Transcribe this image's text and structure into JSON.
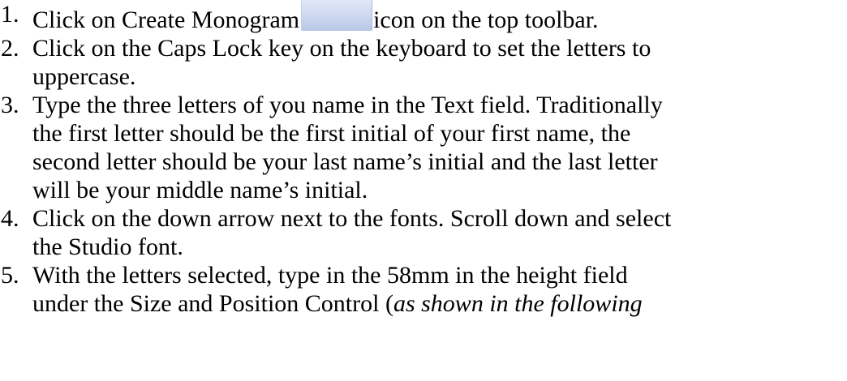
{
  "steps": [
    {
      "number": "1.",
      "lines": [
        "Click on Create Monogram",
        "icon on the top toolbar."
      ],
      "icon": "create-monogram-icon"
    },
    {
      "number": "2.",
      "lines": [
        "Click on the Caps Lock key on the keyboard to set the letters to",
        "uppercase."
      ]
    },
    {
      "number": "3.",
      "lines": [
        "Type the three letters of you name in the Text field. Traditionally",
        "the first letter should be the first initial of your first name, the",
        "second letter should be your last name’s initial and the last letter",
        "will be your middle name’s initial."
      ]
    },
    {
      "number": "4.",
      "lines": [
        "Click on the down arrow next to the fonts. Scroll down and select",
        "the Studio font."
      ]
    },
    {
      "number": "5.",
      "lines": [
        "With the letters selected, type in the 58mm in the height field",
        "under the Size and Position Control (",
        "as shown in the following"
      ]
    }
  ]
}
